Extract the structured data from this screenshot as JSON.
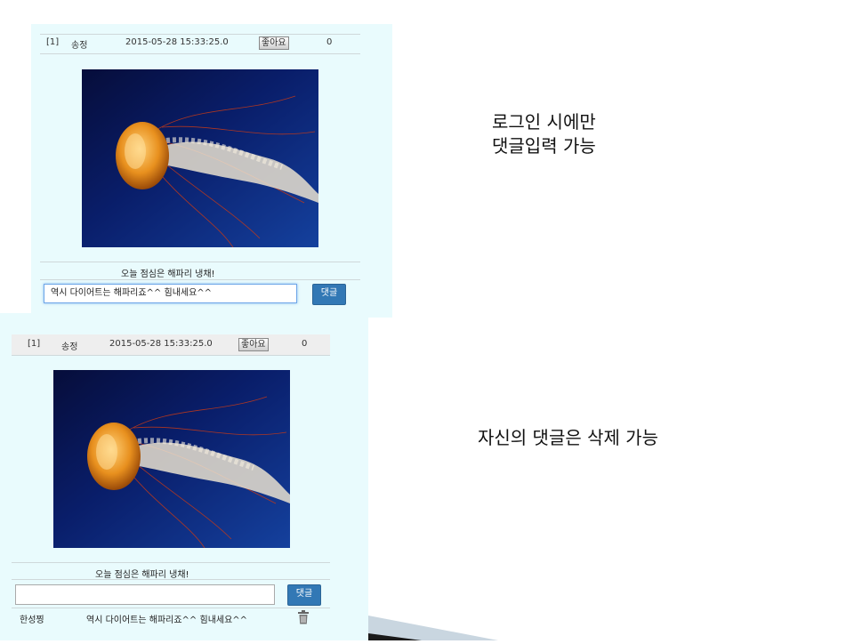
{
  "top_panel": {
    "post": {
      "index": "[1]",
      "author": "송정",
      "datetime": "2015-05-28 15:33:25.0",
      "like_label": "좋아요",
      "like_count": "0"
    },
    "caption": "오늘 점심은 해파리 냉채!",
    "comment_input_value": "역시 다이어트는 해파리죠^^ 힘내세요^^",
    "comment_button_label": "댓글"
  },
  "bottom_panel": {
    "post": {
      "index": "[1]",
      "author": "송정",
      "datetime": "2015-05-28 15:33:25.0",
      "like_label": "좋아요",
      "like_count": "0"
    },
    "caption": "오늘 점심은 해파리 냉채!",
    "comment_input_value": "",
    "comment_button_label": "댓글",
    "comment": {
      "author": "한성찡",
      "text": "역시 다이어트는 해파리죠^^ 힘내세요^^",
      "delete_icon": "trash-icon"
    }
  },
  "notes": {
    "login_line1": "로그인 시에만",
    "login_line2": "댓글입력 가능",
    "delete_note": "자신의 댓글은 삭제 가능"
  },
  "colors": {
    "panel_bg": "#e9fbfd",
    "button_blue": "#3278b5",
    "photo_dark": "#0a1050",
    "photo_light": "#1d5fd8"
  }
}
